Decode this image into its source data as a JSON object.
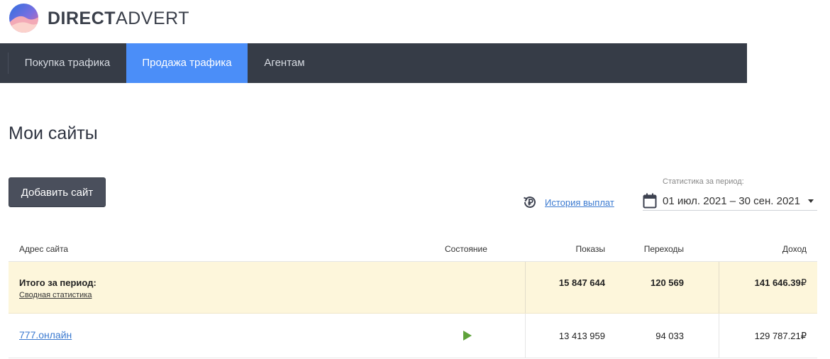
{
  "brand": {
    "bold": "DIRECT",
    "light": "ADVERT"
  },
  "colors": {
    "nav_bg": "#363c47",
    "nav_active": "#4b8ef8",
    "total_row_bg": "#fdf6db",
    "link": "#3b7ad0",
    "play": "#5ea23a"
  },
  "nav": {
    "items": [
      {
        "label": "Покупка трафика",
        "active": false
      },
      {
        "label": "Продажа трафика",
        "active": true
      },
      {
        "label": "Агентам",
        "active": false
      }
    ]
  },
  "page": {
    "title": "Мои сайты"
  },
  "toolbar": {
    "add_site_label": "Добавить сайт",
    "history_icon": "ruble-history-icon",
    "history_label": "История выплат",
    "period_label": "Статистика за период:",
    "period_value": "01 июл. 2021 – 30 сен. 2021",
    "calendar_icon": "calendar-icon"
  },
  "table": {
    "columns": {
      "address": "Адрес сайта",
      "status": "Состояние",
      "impressions": "Показы",
      "clicks": "Переходы",
      "income": "Доход"
    },
    "total": {
      "title": "Итого за период:",
      "link": "Сводная статистика",
      "impressions": "15 847 644",
      "clicks": "120 569",
      "income": "141 646.39",
      "currency": "₽"
    },
    "rows": [
      {
        "site": "777.онлайн",
        "status_icon": "play-icon",
        "impressions": "13 413 959",
        "clicks": "94 033",
        "income": "129 787.21",
        "currency": "₽"
      }
    ]
  }
}
